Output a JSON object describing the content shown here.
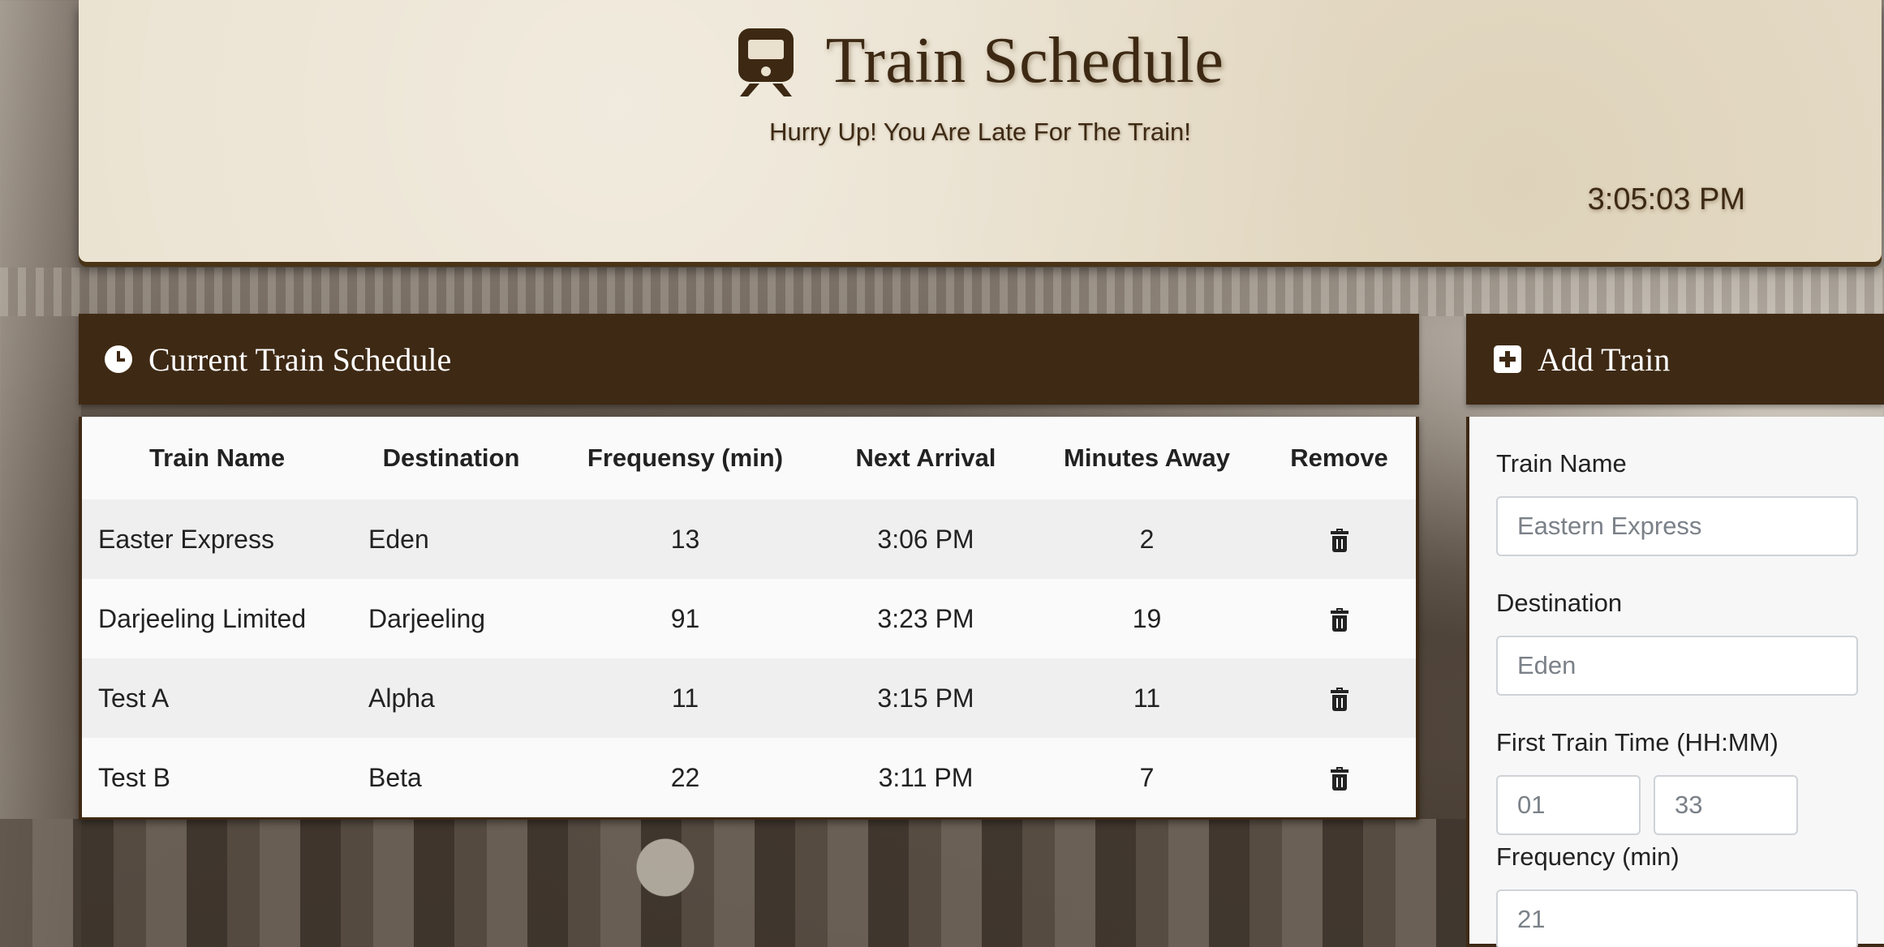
{
  "header": {
    "title": "Train Schedule",
    "subtitle": "Hurry Up! You Are Late For The Train!",
    "clock": "3:05:03 PM"
  },
  "schedule": {
    "title": "Current Train Schedule",
    "columns": [
      "Train Name",
      "Destination",
      "Frequensy (min)",
      "Next Arrival",
      "Minutes Away",
      "Remove"
    ],
    "rows": [
      {
        "name": "Easter Express",
        "destination": "Eden",
        "frequency": "13",
        "next": "3:06 PM",
        "away": "2"
      },
      {
        "name": "Darjeeling Limited",
        "destination": "Darjeeling",
        "frequency": "91",
        "next": "3:23 PM",
        "away": "19"
      },
      {
        "name": "Test A",
        "destination": "Alpha",
        "frequency": "11",
        "next": "3:15 PM",
        "away": "11"
      },
      {
        "name": "Test B",
        "destination": "Beta",
        "frequency": "22",
        "next": "3:11 PM",
        "away": "7"
      }
    ]
  },
  "add_train": {
    "title": "Add Train",
    "name_label": "Train Name",
    "name_placeholder": "Eastern Express",
    "destination_label": "Destination",
    "destination_placeholder": "Eden",
    "first_time_label": "First Train Time (HH:MM)",
    "hour_placeholder": "01",
    "minute_placeholder": "33",
    "frequency_label": "Frequency (min)",
    "frequency_placeholder": "21"
  }
}
